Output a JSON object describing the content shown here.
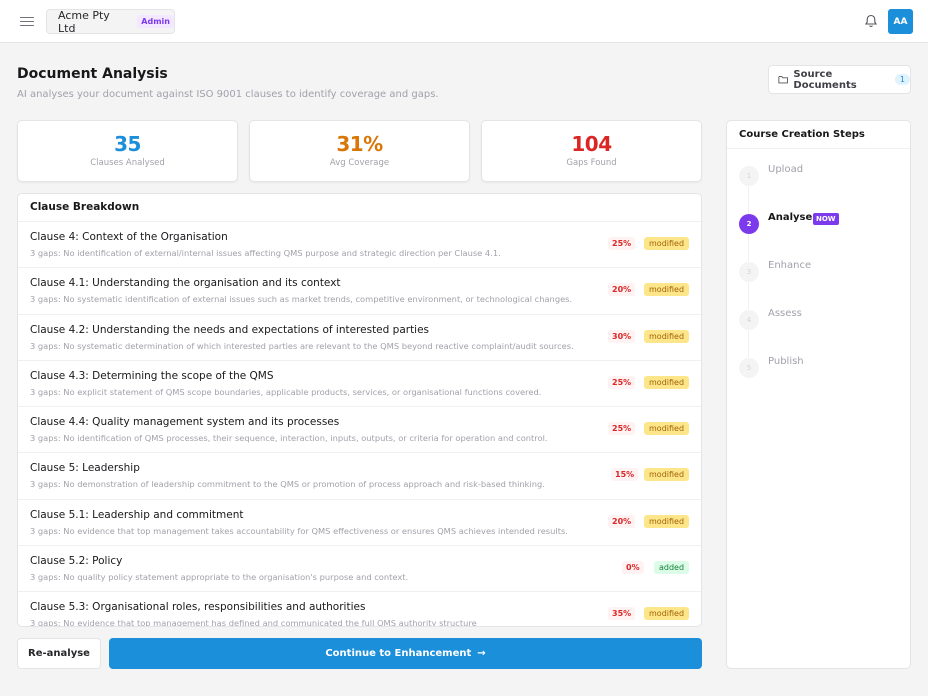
{
  "topbar": {
    "org_name": "Acme Pty Ltd",
    "role_badge": "Admin",
    "avatar_initials": "AA",
    "icons": [
      "menu-icon",
      "bell-icon"
    ],
    "accent_color": "#1c8fdb"
  },
  "header": {
    "title": "Document Analysis",
    "subtitle": "AI analyses your document against ISO 9001 clauses to identify coverage and gaps.",
    "source_button_label": "Source Documents",
    "source_count": "1"
  },
  "stats": [
    {
      "value": "35",
      "label": "Clauses Analysed",
      "color": "#1c8fdb"
    },
    {
      "value": "31%",
      "label": "Avg Coverage",
      "color": "#d97706"
    },
    {
      "value": "104",
      "label": "Gaps Found",
      "color": "#dc2626"
    }
  ],
  "breakdown": {
    "title": "Clause Breakdown",
    "rows": [
      {
        "title": "Clause 4: Context of the Organisation",
        "desc": "3 gaps: No identification of external/internal issues affecting QMS purpose and strategic direction per Clause 4.1.",
        "pct": "25%",
        "status": "modified"
      },
      {
        "title": "Clause 4.1: Understanding the organisation and its context",
        "desc": "3 gaps: No systematic identification of external issues such as market trends, competitive environment, or technological changes.",
        "pct": "20%",
        "status": "modified"
      },
      {
        "title": "Clause 4.2: Understanding the needs and expectations of interested parties",
        "desc": "3 gaps: No systematic determination of which interested parties are relevant to the QMS beyond reactive complaint/audit sources.",
        "pct": "30%",
        "status": "modified"
      },
      {
        "title": "Clause 4.3: Determining the scope of the QMS",
        "desc": "3 gaps: No explicit statement of QMS scope boundaries, applicable products, services, or organisational functions covered.",
        "pct": "25%",
        "status": "modified"
      },
      {
        "title": "Clause 4.4: Quality management system and its processes",
        "desc": "3 gaps: No identification of QMS processes, their sequence, interaction, inputs, outputs, or criteria for operation and control.",
        "pct": "25%",
        "status": "modified"
      },
      {
        "title": "Clause 5: Leadership",
        "desc": "3 gaps: No demonstration of leadership commitment to the QMS or promotion of process approach and risk-based thinking.",
        "pct": "15%",
        "status": "modified"
      },
      {
        "title": "Clause 5.1: Leadership and commitment",
        "desc": "3 gaps: No evidence that top management takes accountability for QMS effectiveness or ensures QMS achieves intended results.",
        "pct": "20%",
        "status": "modified"
      },
      {
        "title": "Clause 5.2: Policy",
        "desc": "3 gaps: No quality policy statement appropriate to the organisation's purpose and context.",
        "pct": "0%",
        "status": "added"
      },
      {
        "title": "Clause 5.3: Organisational roles, responsibilities and authorities",
        "desc": "3 gaps: No evidence that top management has defined and communicated the full QMS authority structure",
        "pct": "35%",
        "status": "modified"
      }
    ]
  },
  "actions": {
    "reanalyse_label": "Re-analyse",
    "continue_label": "Continue to Enhancement",
    "continue_arrow": "→"
  },
  "steps": {
    "title": "Course Creation Steps",
    "items": [
      {
        "number": "1",
        "label": "Upload",
        "active": false
      },
      {
        "number": "2",
        "label": "Analyse",
        "active": true,
        "badge": "NOW"
      },
      {
        "number": "3",
        "label": "Enhance",
        "active": false
      },
      {
        "number": "4",
        "label": "Assess",
        "active": false
      },
      {
        "number": "5",
        "label": "Publish",
        "active": false
      }
    ],
    "active_color": "#7c3aed"
  }
}
